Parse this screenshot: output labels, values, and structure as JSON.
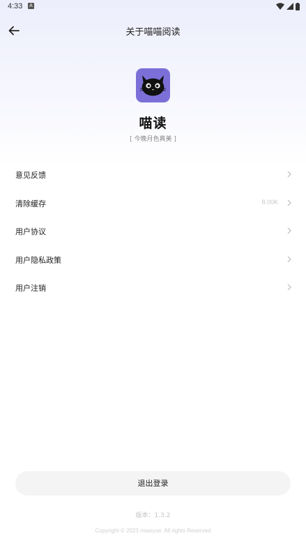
{
  "status_bar": {
    "time": "4:33",
    "notification_icon": "A",
    "icons": [
      "wifi-icon",
      "signal-icon",
      "battery-icon"
    ]
  },
  "header": {
    "title": "关于喵喵阅读",
    "back_icon": "arrow-left-icon"
  },
  "app": {
    "name": "喵读",
    "slogan": "[ 今晚月色真美 ]",
    "logo_icon": "black-cat-icon",
    "logo_color": "#7c70d8"
  },
  "menu": {
    "items": [
      {
        "label": "意见反馈",
        "value": ""
      },
      {
        "label": "清除缓存",
        "value": "8.00K"
      },
      {
        "label": "用户协议",
        "value": ""
      },
      {
        "label": "用户隐私政策",
        "value": ""
      },
      {
        "label": "用户注销",
        "value": ""
      }
    ]
  },
  "footer": {
    "logout_label": "退出登录",
    "version": "版本：1.3.2",
    "copyright": "Copyright © 2023 miaoyue. All rights Reserved"
  }
}
